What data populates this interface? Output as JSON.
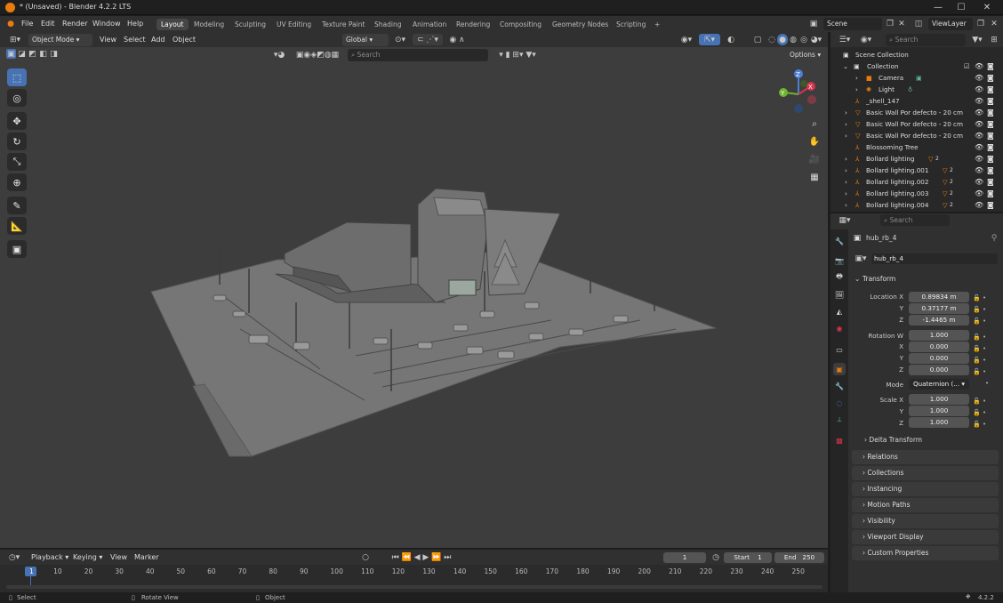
{
  "window": {
    "title": "* (Unsaved) - Blender 4.2.2 LTS",
    "min": "—",
    "max": "☐",
    "close": "✕"
  },
  "menu": [
    "File",
    "Edit",
    "Render",
    "Window",
    "Help"
  ],
  "workspaces": [
    "Layout",
    "Modeling",
    "Sculpting",
    "UV Editing",
    "Texture Paint",
    "Shading",
    "Animation",
    "Rendering",
    "Compositing",
    "Geometry Nodes",
    "Scripting"
  ],
  "workspace_add": "+",
  "scene": {
    "name": "Scene",
    "view_layer": "ViewLayer"
  },
  "viewport_header": {
    "mode": "Object Mode",
    "menus": [
      "View",
      "Select",
      "Add",
      "Object"
    ],
    "transform_orientation": "Global",
    "options": "Options"
  },
  "viewport_search": {
    "placeholder": "Search"
  },
  "outliner": {
    "search_placeholder": "Search",
    "rows": [
      {
        "name": "Scene Collection"
      },
      {
        "name": "Collection"
      },
      {
        "name": "Camera"
      },
      {
        "name": "Light"
      },
      {
        "name": "_shell_147"
      },
      {
        "name": "Basic Wall Por defecto - 20 cm"
      },
      {
        "name": "Basic Wall Por defecto - 20 cm"
      },
      {
        "name": "Basic Wall Por defecto - 20 cm"
      },
      {
        "name": "Blossoming Tree"
      },
      {
        "name": "Bollard lighting",
        "badge": "2"
      },
      {
        "name": "Bollard lighting.001",
        "badge": "2"
      },
      {
        "name": "Bollard lighting.002",
        "badge": "2"
      },
      {
        "name": "Bollard lighting.003",
        "badge": "2"
      },
      {
        "name": "Bollard lighting.004",
        "badge": "2"
      }
    ]
  },
  "properties": {
    "search_placeholder": "Search",
    "object_name": "hub_rb_4",
    "data_name": "hub_rb_4",
    "transform_label": "Transform",
    "location": {
      "label": "Location X",
      "x": "0.89834 m",
      "y": "0.37177 m",
      "z": "-1.4465 m"
    },
    "rotation": {
      "label": "Rotation W",
      "w": "1.000",
      "x": "0.000",
      "y": "0.000",
      "z": "0.000"
    },
    "mode": {
      "label": "Mode",
      "value": "Quaternion (..."
    },
    "scale": {
      "label": "Scale X",
      "x": "1.000",
      "y": "1.000",
      "z": "1.000"
    },
    "axis_labels": {
      "x": "X",
      "y": "Y",
      "z": "Z"
    },
    "delta_transform": "Delta Transform",
    "panels": [
      "Relations",
      "Collections",
      "Instancing",
      "Motion Paths",
      "Visibility",
      "Viewport Display",
      "Custom Properties"
    ]
  },
  "timeline": {
    "menus": [
      "Playback",
      "Keying",
      "View",
      "Marker"
    ],
    "current_frame": "1",
    "start_label": "Start",
    "start": "1",
    "end_label": "End",
    "end": "250",
    "ticks": [
      "1",
      "10",
      "20",
      "30",
      "40",
      "50",
      "60",
      "70",
      "80",
      "90",
      "100",
      "110",
      "120",
      "130",
      "140",
      "150",
      "160",
      "170",
      "180",
      "190",
      "200",
      "210",
      "220",
      "230",
      "240",
      "250"
    ]
  },
  "status": {
    "select": "Select",
    "rotate": "Rotate View",
    "object": "Object",
    "version": "4.2.2"
  },
  "gizmo": {
    "x": "X",
    "y": "Y",
    "z": "Z"
  },
  "colors": {
    "accent": "#4772b3",
    "orange": "#e87d0d",
    "viewport_bg": "#3d3d3d"
  }
}
